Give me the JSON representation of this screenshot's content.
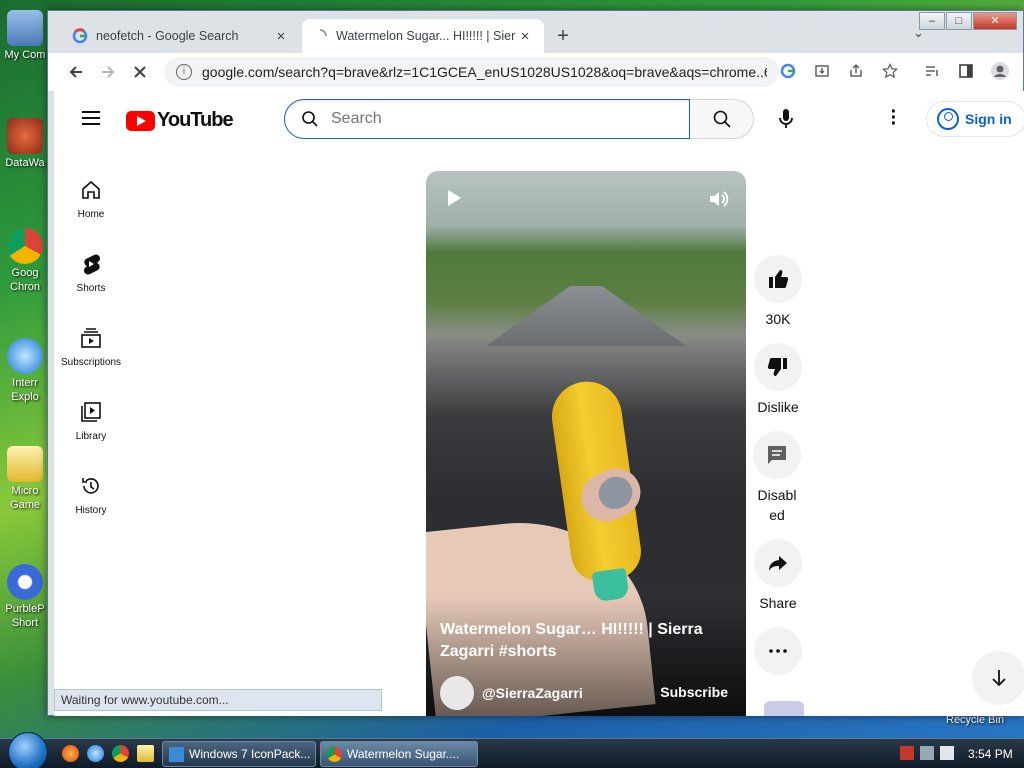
{
  "desktop": {
    "icons": [
      {
        "label": "My Com",
        "color": "#5a8ac8"
      },
      {
        "label": "DataWa",
        "color": "#c84a2a"
      },
      {
        "label": "Goog Chron",
        "color": "#2a9a4a"
      },
      {
        "label": "Interr Explo",
        "color": "#2a7ad8"
      },
      {
        "label": "Micro Game",
        "color": "#e8c84a"
      },
      {
        "label": "PurbleP Short",
        "color": "#4a7ae8"
      }
    ],
    "recycle_label": "Recycle Bin"
  },
  "browser": {
    "tabs": [
      {
        "title": "neofetch - Google Search",
        "close": "×"
      },
      {
        "title": "Watermelon Sugar... HI!!!!! | Sierr",
        "close": "×"
      }
    ],
    "new_tab": "+",
    "tab_menu": "⌄",
    "window_buttons": {
      "minimize": "–",
      "maximize": "□",
      "close": "✕"
    },
    "url": "google.com/search?q=brave&rlz=1C1GCEA_enUS1028US1028&oq=brave&aqs=chrome..6...",
    "status": "Waiting for www.youtube.com..."
  },
  "youtube": {
    "logo_text": "YouTube",
    "search_placeholder": "Search",
    "sign_in": "Sign in",
    "sidebar": [
      {
        "label": "Home",
        "icon": "home-icon"
      },
      {
        "label": "Shorts",
        "icon": "shorts-icon"
      },
      {
        "label": "Subscriptions",
        "icon": "subscriptions-icon"
      },
      {
        "label": "Library",
        "icon": "library-icon"
      },
      {
        "label": "History",
        "icon": "history-icon"
      }
    ],
    "video": {
      "title": "Watermelon Sugar… HI!!!!! | Sierra Zagarri #shorts",
      "channel": "@SierraZagarri",
      "subscribe": "Subscribe"
    },
    "actions": {
      "likes": "30K",
      "dislike": "Dislike",
      "comments": "Disabled",
      "share": "Share"
    }
  },
  "taskbar": {
    "tasks": [
      {
        "label": "Windows 7 IconPack..."
      },
      {
        "label": "Watermelon Sugar...."
      }
    ],
    "clock": "3:54 PM"
  }
}
